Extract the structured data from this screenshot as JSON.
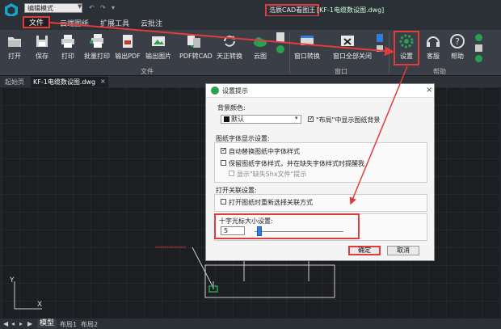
{
  "titlebar": {
    "mode": "编辑模式",
    "app_title": "浩辰CAD看图王",
    "doc_title": "[KF-1电缆数设图.dwg]"
  },
  "ribbon_tabs": [
    "文件",
    "云端图纸",
    "扩展工具",
    "云批注"
  ],
  "tools": [
    {
      "label": "打开",
      "icon": "folder-open-icon"
    },
    {
      "label": "保存",
      "icon": "save-icon"
    },
    {
      "label": "打印",
      "icon": "print-icon"
    },
    {
      "label": "批量打印",
      "icon": "batch-print-icon"
    },
    {
      "label": "输出PDF",
      "icon": "pdf-export-icon"
    },
    {
      "label": "输出图片",
      "icon": "image-export-icon"
    },
    {
      "label": "PDF转CAD",
      "icon": "pdf-to-cad-icon"
    },
    {
      "label": "天正转换",
      "icon": "convert-icon"
    },
    {
      "label": "云图",
      "icon": "cloud-icon"
    },
    {
      "label": "窗口转换",
      "icon": "window-switch-icon"
    },
    {
      "label": "窗口全部关闭",
      "icon": "close-all-windows-icon"
    },
    {
      "label": "设置",
      "icon": "gear-icon"
    },
    {
      "label": "客服",
      "icon": "headset-icon"
    },
    {
      "label": "帮助",
      "icon": "help-icon"
    }
  ],
  "groups": {
    "file": "文件",
    "window": "窗口",
    "help": "帮助"
  },
  "doc_tabs": {
    "start": "起始页",
    "active": "KF-1电缆数设图.dwg",
    "close": "×"
  },
  "bottom_tabs": {
    "model": "模型",
    "layout1": "布局1",
    "layout2": "布局2"
  },
  "canvas": {
    "y_axis": "Y",
    "x_axis": "X"
  },
  "dialog": {
    "title": "设置提示",
    "close": "×",
    "bg_color_label": "背景颜色:",
    "bg_color_value": "默认",
    "layout_bg_checkbox": "\"布局\"中显示图纸背景",
    "font_section": "图纸字体显示设置:",
    "auto_replace_font": "自动替换图纸中字体样式",
    "keep_font_style": "保留图纸字体样式，并在缺失字体样式时提醒我",
    "show_missing_shx": "显示\"缺失Shx文件\"提示",
    "open_section": "打开关联设置:",
    "reselect_assoc": "打开图纸时重新选择关联方式",
    "crosshair_section": "十字光标大小设置:",
    "crosshair_value": "5",
    "crosshair_fraction": 0.05,
    "ok": "确定",
    "cancel": "取消"
  },
  "colors": {
    "highlight": "#e23b3b",
    "accent": "#2f7ed8"
  }
}
